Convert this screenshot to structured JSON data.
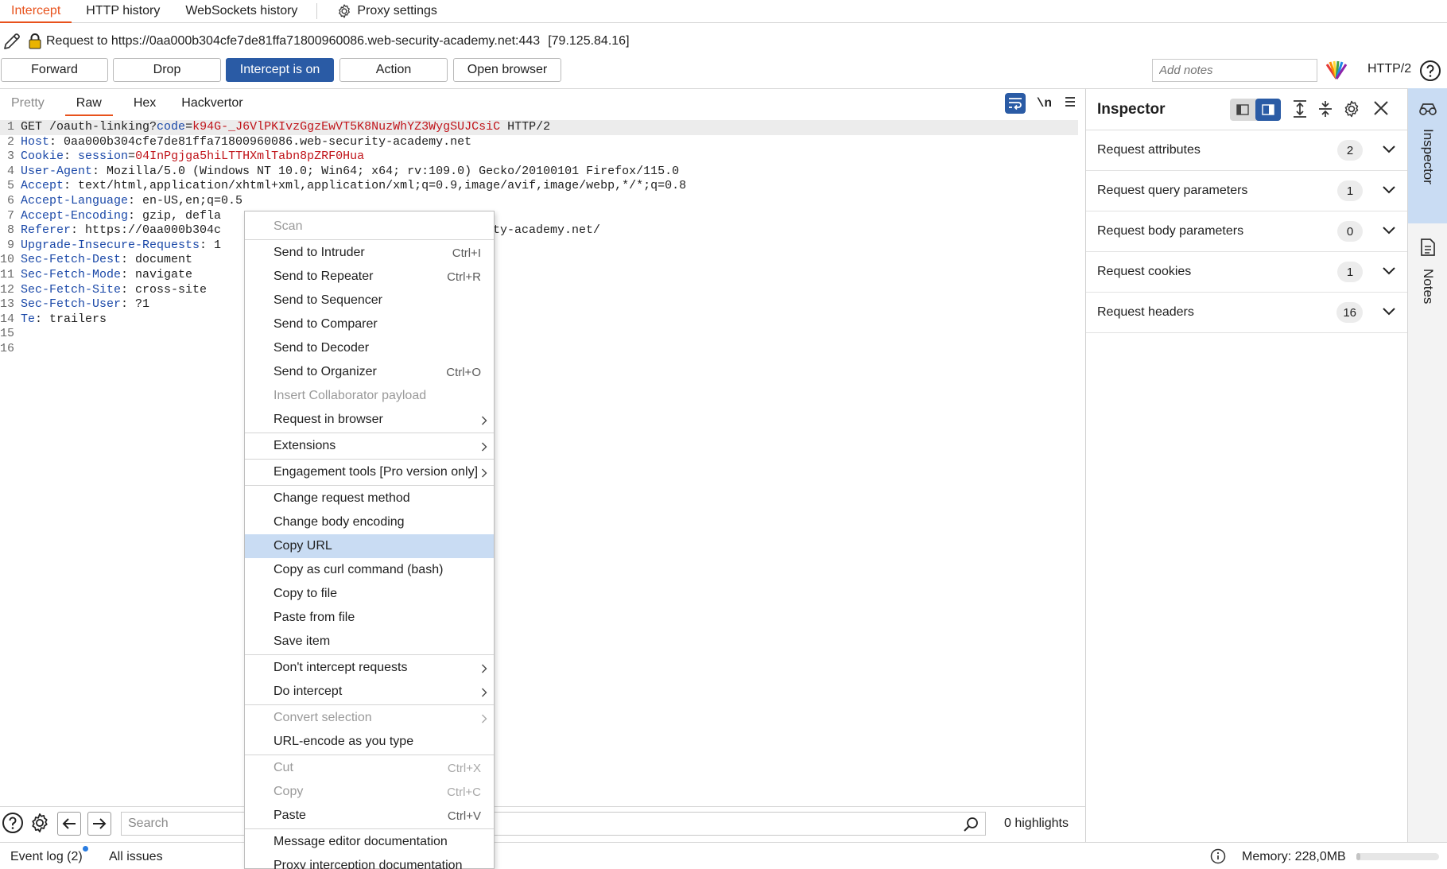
{
  "top_tabs": [
    {
      "label": "Intercept",
      "active": true
    },
    {
      "label": "HTTP history"
    },
    {
      "label": "WebSockets history"
    },
    {
      "label": "Proxy settings",
      "icon": "gear-icon"
    }
  ],
  "request": {
    "text": "Request to https://0aa000b304cfe7de81ffa71800960086.web-security-academy.net:443",
    "ip": "[79.125.84.16]"
  },
  "toolbar": {
    "forward": "Forward",
    "drop": "Drop",
    "intercept": "Intercept is on",
    "action": "Action",
    "open_browser": "Open browser",
    "notes_placeholder": "Add notes",
    "http_version": "HTTP/2"
  },
  "editor": {
    "tabs": [
      "Pretty",
      "Raw",
      "Hex",
      "Hackvertor"
    ],
    "active_tab": "Raw",
    "newline_toggle": "\\n",
    "line_numbers": [
      "1",
      "2",
      "3",
      "4",
      "5",
      "6",
      "7",
      "8",
      "9",
      "10",
      "11",
      "12",
      "13",
      "14",
      "15",
      "16"
    ],
    "lines": {
      "l1_method": "GET ",
      "l1_path": "/oauth-linking?",
      "l1_param": "code",
      "l1_eq": "=",
      "l1_value": "k94G-_J6VlPKIvzGgzEwVT5K8NuzWhYZ3WygSUJCsiC",
      "l1_proto": " HTTP/2",
      "l2_key": "Host",
      "l2_val": ": 0aa000b304cfe7de81ffa71800960086.web-security-academy.net",
      "l3_key": "Cookie",
      "l3_colon": ": ",
      "l3_name": "session",
      "l3_eq": "=",
      "l3_val": "04InPgjga5hiLTTHXmlTabn8pZRF0Hua",
      "l4_key": "User-Agent",
      "l4_val": ": Mozilla/5.0 (Windows NT 10.0; Win64; x64; rv:109.0) Gecko/20100101 Firefox/115.0",
      "l5_key": "Accept",
      "l5_val": ": text/html,application/xhtml+xml,application/xml;q=0.9,image/avif,image/webp,*/*;q=0.8",
      "l6_key": "Accept-Language",
      "l6_val": ": en-US,en;q=0.5",
      "l7_key": "Accept-Encoding",
      "l7_val": ": gzip, defla",
      "l8_key": "Referer",
      "l8_val": ": https://0aa000b304c",
      "l8_tail": "ty-academy.net/",
      "l9_key": "Upgrade-Insecure-Requests",
      "l9_val": ": 1",
      "l10_key": "Sec-Fetch-Dest",
      "l10_val": ": document",
      "l11_key": "Sec-Fetch-Mode",
      "l11_val": ": navigate",
      "l12_key": "Sec-Fetch-Site",
      "l12_val": ": cross-site",
      "l13_key": "Sec-Fetch-User",
      "l13_val": ": ?1",
      "l14_key": "Te",
      "l14_val": ": trailers"
    }
  },
  "search": {
    "placeholder": "Search",
    "highlights": "0 highlights"
  },
  "inspector": {
    "title": "Inspector",
    "rows": [
      {
        "label": "Request attributes",
        "count": "2"
      },
      {
        "label": "Request query parameters",
        "count": "1"
      },
      {
        "label": "Request body parameters",
        "count": "0"
      },
      {
        "label": "Request cookies",
        "count": "1"
      },
      {
        "label": "Request headers",
        "count": "16"
      }
    ]
  },
  "rail": {
    "inspector": "Inspector",
    "notes": "Notes"
  },
  "status": {
    "event_log": "Event log (2)",
    "all_issues": "All issues",
    "memory": "Memory: 228,0MB",
    "memory_fraction": 0.05
  },
  "context_menu": {
    "items": [
      {
        "label": "Scan",
        "disabled": true
      },
      {
        "sep": true
      },
      {
        "label": "Send to Intruder",
        "shortcut": "Ctrl+I"
      },
      {
        "label": "Send to Repeater",
        "shortcut": "Ctrl+R"
      },
      {
        "label": "Send to Sequencer"
      },
      {
        "label": "Send to Comparer"
      },
      {
        "label": "Send to Decoder"
      },
      {
        "label": "Send to Organizer",
        "shortcut": "Ctrl+O"
      },
      {
        "label": "Insert Collaborator payload",
        "disabled": true
      },
      {
        "label": "Request in browser",
        "submenu": true
      },
      {
        "sep": true
      },
      {
        "label": "Extensions",
        "submenu": true
      },
      {
        "sep": true
      },
      {
        "label": "Engagement tools [Pro version only]",
        "submenu": true
      },
      {
        "sep": true
      },
      {
        "label": "Change request method"
      },
      {
        "label": "Change body encoding"
      },
      {
        "label": "Copy URL",
        "hover": true
      },
      {
        "label": "Copy as curl command (bash)"
      },
      {
        "label": "Copy to file"
      },
      {
        "label": "Paste from file"
      },
      {
        "label": "Save item"
      },
      {
        "sep": true
      },
      {
        "label": "Don't intercept requests",
        "submenu": true
      },
      {
        "label": "Do intercept",
        "submenu": true
      },
      {
        "sep": true
      },
      {
        "label": "Convert selection",
        "submenu": true,
        "disabled": true
      },
      {
        "label": "URL-encode as you type"
      },
      {
        "sep": true
      },
      {
        "label": "Cut",
        "shortcut": "Ctrl+X",
        "disabled": true
      },
      {
        "label": "Copy",
        "shortcut": "Ctrl+C",
        "disabled": true
      },
      {
        "label": "Paste",
        "shortcut": "Ctrl+V"
      },
      {
        "sep": true
      },
      {
        "label": "Message editor documentation"
      },
      {
        "label": "Proxy interception documentation"
      }
    ]
  },
  "colors": {
    "accent": "#e8521c",
    "primary_button": "#2a5ba5",
    "header_key": "#1a48a8",
    "param_value": "#c0141a",
    "menu_hover": "#c9dcf3"
  }
}
